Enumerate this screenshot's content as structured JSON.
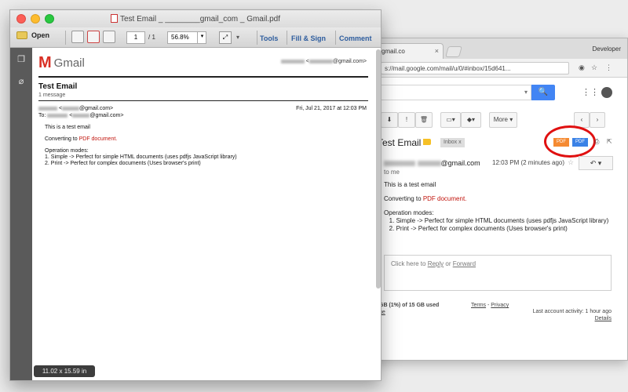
{
  "chrome": {
    "tab_title": "gmail.co",
    "tab_close": "×",
    "profile": "Developer",
    "url": "s://mail.google.com/mail/u/0/#inbox/15d641...",
    "search_dropdown": "▾",
    "search_icon": "🔍",
    "apps_icon": "⋮⋮⋮",
    "toolbar_more": "More ▾",
    "subject": "Test Email",
    "inbox_chip": "Inbox  x",
    "pdf_button_1": "PDF",
    "pdf_button_2": "PDF",
    "sender_suffix": "@gmail.com",
    "time": "12:03 PM (2 minutes ago)",
    "to_me": "to me",
    "reply_icon": "↶ ▾",
    "body": {
      "line1": "This is a test email",
      "converting_prefix": "Converting to ",
      "converting_link": "PDF document.",
      "modes_title": "Operation modes:",
      "mode1": "1. Simple -> Perfect for simple HTML documents (uses pdfjs JavaScript library)",
      "mode2": "2. Print -> Perfect for complex documents (Uses browser's print)"
    },
    "reply_box": {
      "prefix": "Click here to ",
      "reply": "Reply",
      "or": " or ",
      "forward": "Forward"
    },
    "footer": {
      "storage": "GB (1%) of 15 GB used",
      "manage": "ge",
      "terms": "Terms",
      "dash": " - ",
      "privacy": "Privacy",
      "activity": "Last account activity: 1 hour ago",
      "details": "Details"
    }
  },
  "preview": {
    "window_title": "Test Email _ ________gmail_com _ Gmail.pdf",
    "toolbar": {
      "open": "Open",
      "page_current": "1",
      "page_total": "/ 1",
      "zoom": "56.8%",
      "zoom_dd": "▾",
      "tools": "Tools",
      "fill_sign": "Fill & Sign",
      "comment": "Comment"
    },
    "size_badge": "11.02 x 15.59 in"
  },
  "pdf": {
    "logo_text": "Gmail",
    "user_email": "@gmail.com>",
    "subject": "Test Email",
    "message_count": "1 message",
    "from_suffix": "@gmail.com>",
    "to_prefix": "To:",
    "to_suffix": "@gmail.com>",
    "date": "Fri, Jul 21, 2017 at 12:03 PM",
    "body": {
      "line1": "This is a test email",
      "converting_prefix": "Converting to ",
      "converting_link": "PDF document.",
      "modes_title": "Operation modes:",
      "mode1": "1. Simple -> Perfect for simple HTML documents (uses pdfjs JavaScript library)",
      "mode2": "2. Print -> Perfect for complex documents (Uses browser's print)"
    }
  },
  "colors": {
    "accent_blue": "#4285f4",
    "highlight_red": "#e01010",
    "pdf_orange": "#f58a32",
    "link_red": "#c1140c"
  }
}
